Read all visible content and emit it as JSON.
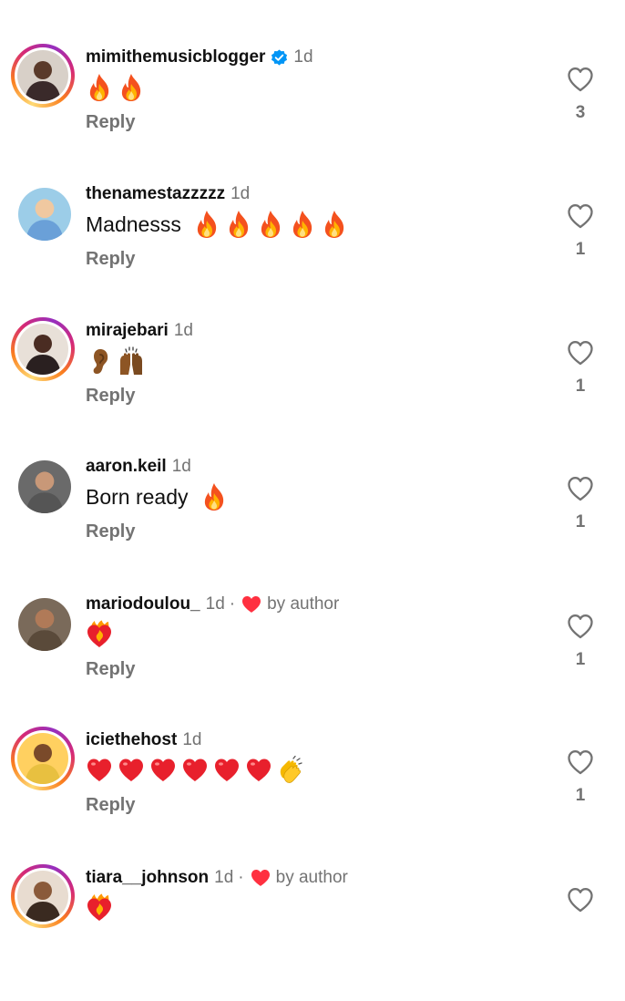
{
  "comments": [
    {
      "username": "mimithemusicblogger",
      "verified": true,
      "time": "1d",
      "liked_by_author": false,
      "by_author": "",
      "text": "",
      "emojis": [
        "fire",
        "fire"
      ],
      "reply": "Reply",
      "likes": "3",
      "ring": true,
      "avatar_color": "#3a2a2a"
    },
    {
      "username": "thenamestazzzzz",
      "verified": false,
      "time": "1d",
      "liked_by_author": false,
      "by_author": "",
      "text": "Madnesss",
      "emojis": [
        "fire",
        "fire",
        "fire",
        "fire",
        "fire"
      ],
      "reply": "Reply",
      "likes": "1",
      "ring": false,
      "avatar_color": "#6aa0d8"
    },
    {
      "username": "mirajebari",
      "verified": false,
      "time": "1d",
      "liked_by_author": false,
      "by_author": "",
      "text": "",
      "emojis": [
        "ear",
        "raised-hands"
      ],
      "reply": "Reply",
      "likes": "1",
      "ring": true,
      "avatar_color": "#2a2020"
    },
    {
      "username": "aaron.keil",
      "verified": false,
      "time": "1d",
      "liked_by_author": false,
      "by_author": "",
      "text": "Born ready",
      "emojis": [
        "fire"
      ],
      "reply": "Reply",
      "likes": "1",
      "ring": false,
      "avatar_color": "#555555"
    },
    {
      "username": "mariodoulou_",
      "verified": false,
      "time": "1d",
      "liked_by_author": true,
      "by_author": "by author",
      "text": "",
      "emojis": [
        "heart-on-fire"
      ],
      "reply": "Reply",
      "likes": "1",
      "ring": false,
      "avatar_color": "#5a4a3a"
    },
    {
      "username": "iciethehost",
      "verified": false,
      "time": "1d",
      "liked_by_author": false,
      "by_author": "",
      "text": "",
      "emojis": [
        "red-heart",
        "red-heart",
        "red-heart",
        "red-heart",
        "red-heart",
        "red-heart",
        "clapping"
      ],
      "reply": "Reply",
      "likes": "1",
      "ring": true,
      "avatar_color": "#e8c040"
    },
    {
      "username": "tiara__johnson",
      "verified": false,
      "time": "1d",
      "liked_by_author": true,
      "by_author": "by author",
      "text": "",
      "emojis": [
        "heart-on-fire"
      ],
      "reply": "",
      "likes": "",
      "ring": true,
      "avatar_color": "#3a2a20"
    }
  ],
  "separator": "·",
  "colors": {
    "accent_red": "#ff3040",
    "verified_blue": "#0095f6",
    "secondary_text": "#737373"
  }
}
